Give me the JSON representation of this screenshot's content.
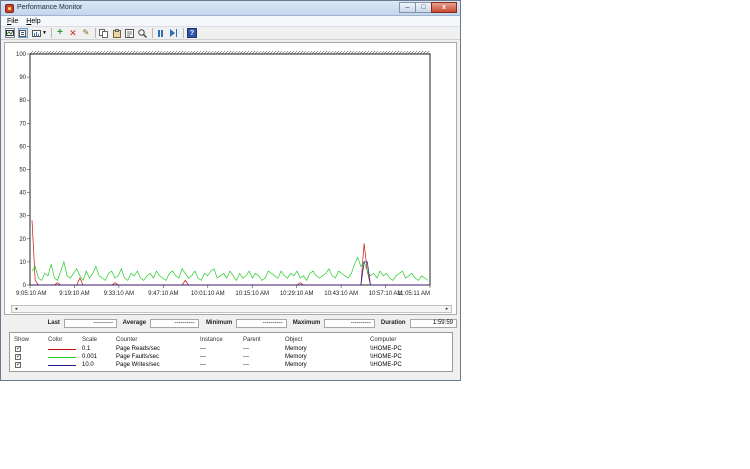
{
  "window": {
    "title": "Performance Monitor",
    "caption_buttons": {
      "minimize": "–",
      "maximize": "□",
      "close": "x"
    }
  },
  "menu": [
    "File",
    "Help"
  ],
  "toolbar": {
    "icons": [
      "view-current-activity-icon",
      "view-log-data-icon",
      "change-graph-type-icon",
      "add-counter-icon",
      "delete-counter-icon",
      "highlight-icon",
      "copy-properties-icon",
      "paste-counter-list-icon",
      "properties-icon",
      "zoom-icon",
      "freeze-display-icon",
      "update-data-icon",
      "help-icon"
    ]
  },
  "chart_data": {
    "type": "line",
    "y_ticks": [
      "100",
      "90",
      "80",
      "70",
      "60",
      "50",
      "40",
      "30",
      "20",
      "10",
      "0"
    ],
    "ylim": [
      0,
      100
    ],
    "x_ticks": [
      "9:05:10 AM",
      "9:19:10 AM",
      "9:33:10 AM",
      "9:47:10 AM",
      "10:01:10 AM",
      "10:15:10 AM",
      "10:29:10 AM",
      "10:43:10 AM",
      "10:57:10 AM",
      "11:05:11 AM"
    ],
    "grid": false,
    "series": [
      {
        "name": "Page Reads/sec",
        "color": "#d01010",
        "values": [
          28,
          2,
          0,
          0,
          0,
          0,
          0,
          0,
          1,
          0,
          0,
          0,
          0,
          0,
          0,
          3,
          0,
          0,
          0,
          0,
          0,
          0,
          0,
          0,
          0,
          0,
          1,
          0,
          0,
          0,
          0,
          0,
          0,
          0,
          0,
          0,
          0,
          0,
          0,
          0,
          0,
          0,
          0,
          0,
          0,
          0,
          0,
          0,
          2,
          0,
          0,
          0,
          0,
          0,
          0,
          0,
          0,
          0,
          0,
          0,
          0,
          0,
          0,
          0,
          0,
          0,
          0,
          0,
          0,
          0,
          0,
          0,
          0,
          0,
          0,
          0,
          0,
          0,
          0,
          0,
          0,
          0,
          0,
          0,
          1,
          0,
          0,
          0,
          0,
          0,
          0,
          0,
          0,
          0,
          0,
          0,
          0,
          0,
          0,
          0,
          0,
          0,
          0,
          0,
          18,
          6,
          0,
          0,
          0,
          0,
          0,
          0,
          0,
          0,
          0,
          0,
          0,
          0,
          0,
          0,
          0,
          0,
          0,
          0,
          0
        ]
      },
      {
        "name": "Page Faults/sec",
        "color": "#22cc22",
        "values": [
          6,
          8,
          3,
          2,
          5,
          4,
          9,
          3,
          2,
          6,
          10,
          4,
          3,
          5,
          7,
          4,
          2,
          6,
          3,
          5,
          8,
          4,
          3,
          2,
          5,
          6,
          3,
          4,
          7,
          3,
          2,
          5,
          4,
          6,
          3,
          2,
          4,
          5,
          3,
          6,
          4,
          3,
          2,
          5,
          6,
          4,
          3,
          7,
          5,
          3,
          4,
          6,
          3,
          2,
          5,
          4,
          6,
          7,
          3,
          4,
          5,
          3,
          6,
          4,
          2,
          5,
          3,
          4,
          6,
          3,
          5,
          4,
          2,
          3,
          6,
          5,
          4,
          3,
          6,
          4,
          3,
          5,
          4,
          6,
          3,
          4,
          2,
          5,
          6,
          4,
          3,
          4,
          5,
          7,
          4,
          3,
          6,
          5,
          4,
          3,
          5,
          9,
          12,
          8,
          10,
          6,
          4,
          5,
          3,
          6,
          4,
          5,
          3,
          2,
          4,
          5,
          6,
          3,
          4,
          5,
          3,
          2,
          4,
          3,
          2
        ]
      },
      {
        "name": "Page Writes/sec",
        "color": "#1a1a8a",
        "values": [
          0,
          0,
          0,
          0,
          0,
          0,
          0,
          0,
          0,
          0,
          0,
          0,
          0,
          0,
          0,
          0,
          0,
          0,
          0,
          0,
          0,
          0,
          0,
          0,
          0,
          0,
          0,
          0,
          0,
          0,
          0,
          0,
          0,
          0,
          0,
          0,
          0,
          0,
          0,
          0,
          0,
          0,
          0,
          0,
          0,
          0,
          0,
          0,
          0,
          0,
          0,
          0,
          0,
          0,
          0,
          0,
          0,
          0,
          0,
          0,
          0,
          0,
          0,
          0,
          0,
          0,
          0,
          0,
          0,
          0,
          0,
          0,
          0,
          0,
          0,
          0,
          0,
          0,
          0,
          0,
          0,
          0,
          0,
          0,
          0,
          0,
          0,
          0,
          0,
          0,
          0,
          0,
          0,
          0,
          0,
          0,
          0,
          0,
          0,
          0,
          0,
          0,
          0,
          0,
          10,
          10,
          0,
          0,
          0,
          0,
          0,
          0,
          0,
          0,
          0,
          0,
          0,
          0,
          0,
          0,
          0,
          0,
          0,
          0,
          0
        ]
      }
    ]
  },
  "stats": {
    "last_label": "Last",
    "last_value": "----------",
    "average_label": "Average",
    "average_value": "----------",
    "minimum_label": "Minimum",
    "minimum_value": "----------",
    "maximum_label": "Maximum",
    "maximum_value": "----------",
    "duration_label": "Duration",
    "duration_value": "1:59:59"
  },
  "legend": {
    "headers": {
      "show": "Show",
      "color": "Color",
      "scale": "Scale",
      "counter": "Counter",
      "instance": "Instance",
      "parent": "Parent",
      "object": "Object",
      "computer": "Computer"
    },
    "rows": [
      {
        "checked": "✓",
        "color": "#d01010",
        "scale": "0.1",
        "counter": "Page Reads/sec",
        "instance": "---",
        "parent": "---",
        "object": "Memory",
        "computer": "\\\\HOME-PC"
      },
      {
        "checked": "✓",
        "color": "#22cc22",
        "scale": "0.001",
        "counter": "Page Faults/sec",
        "instance": "---",
        "parent": "---",
        "object": "Memory",
        "computer": "\\\\HOME-PC"
      },
      {
        "checked": "✓",
        "color": "#1a1a8a",
        "scale": "10.0",
        "counter": "Page Writes/sec",
        "instance": "---",
        "parent": "---",
        "object": "Memory",
        "computer": "\\\\HOME-PC"
      }
    ]
  }
}
